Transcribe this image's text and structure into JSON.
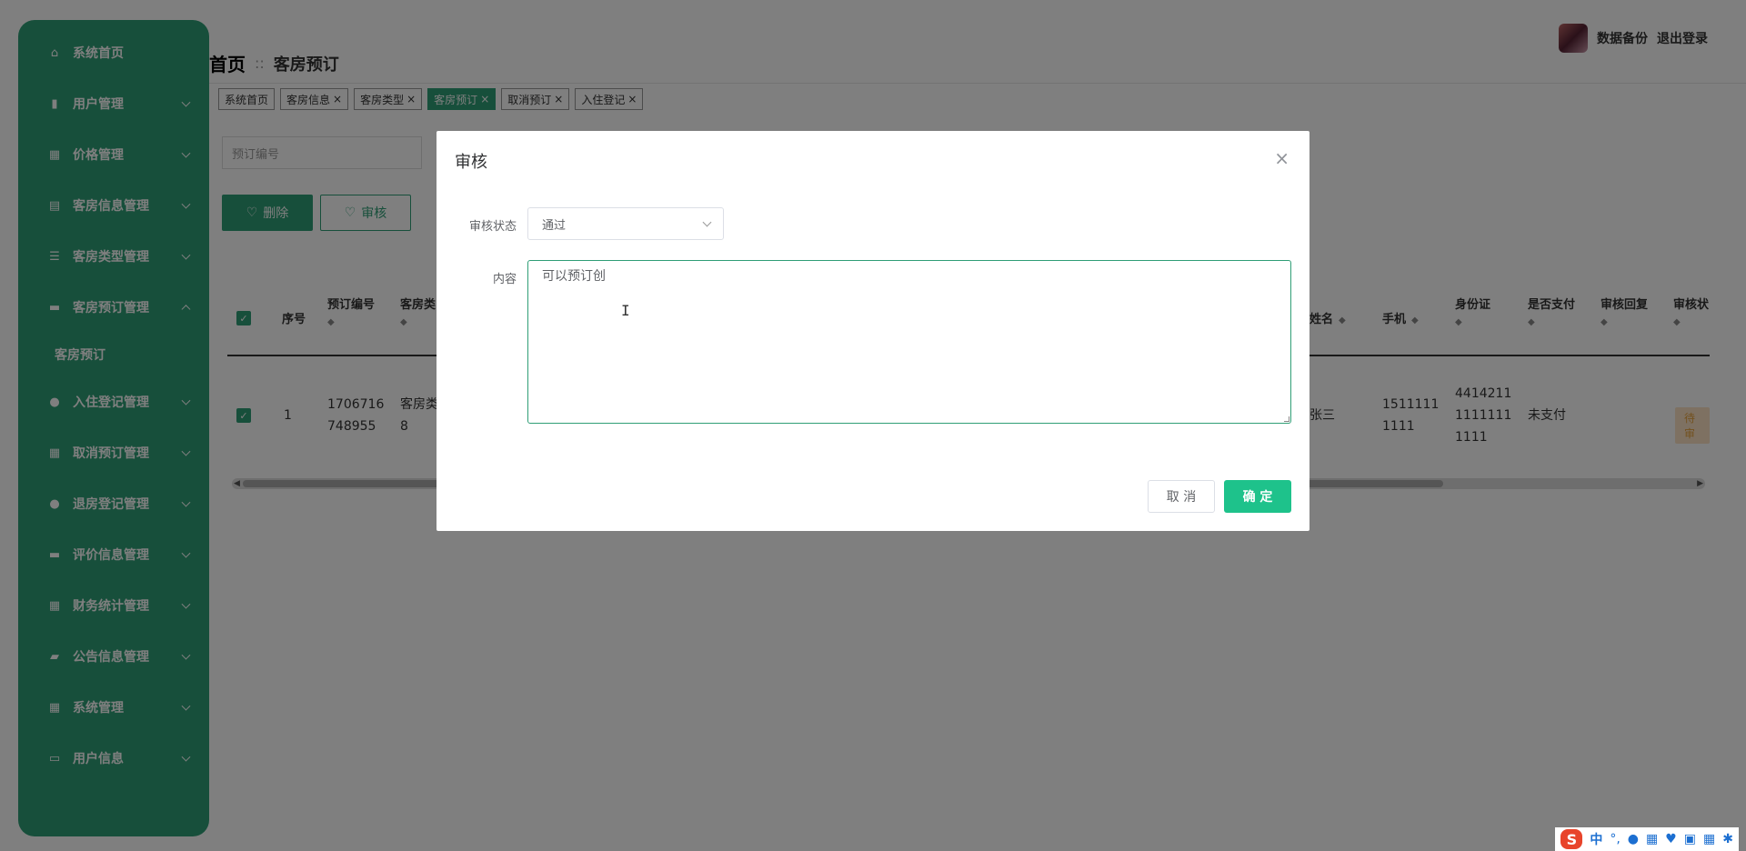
{
  "sidebar": {
    "items": [
      {
        "icon": "home-icon",
        "label": "系统首页"
      },
      {
        "icon": "clipboard-icon",
        "label": "用户管理"
      },
      {
        "icon": "grid-icon",
        "label": "价格管理"
      },
      {
        "icon": "table-icon",
        "label": "客房信息管理"
      },
      {
        "icon": "sliders-icon",
        "label": "客房类型管理"
      },
      {
        "icon": "monitor-icon",
        "label": "客房预订管理"
      },
      {
        "icon": "user-icon",
        "label": "入住登记管理"
      },
      {
        "icon": "grid-icon",
        "label": "取消预订管理"
      },
      {
        "icon": "bulb-icon",
        "label": "退房登记管理"
      },
      {
        "icon": "monitor-icon",
        "label": "评价信息管理"
      },
      {
        "icon": "grid-icon",
        "label": "财务统计管理"
      },
      {
        "icon": "chat-icon",
        "label": "公告信息管理"
      },
      {
        "icon": "grid-icon",
        "label": "系统管理"
      },
      {
        "icon": "card-icon",
        "label": "用户信息"
      }
    ],
    "submenu": {
      "label": "客房预订"
    }
  },
  "header": {
    "breadcrumb_home": "首页",
    "breadcrumb_sep": "::",
    "breadcrumb_current": "客房预订",
    "backup_label": "数据备份",
    "logout_label": "退出登录"
  },
  "tags": [
    {
      "label": "系统首页",
      "closable": false
    },
    {
      "label": "客房信息",
      "closable": true
    },
    {
      "label": "客房类型",
      "closable": true
    },
    {
      "label": "客房预订",
      "closable": true,
      "active": true
    },
    {
      "label": "取消预订",
      "closable": true
    },
    {
      "label": "入住登记",
      "closable": true
    }
  ],
  "search": {
    "placeholder": "预订编号"
  },
  "actions": {
    "delete_label": "删除",
    "audit_label": "审核"
  },
  "table": {
    "headers": {
      "index": "序号",
      "booking_no": "预订编号",
      "room_type": "客房类",
      "name": "姓名",
      "phone": "手机",
      "id_card": "身份证",
      "paid": "是否支付",
      "audit_reply": "审核回复",
      "audit_status": "审核状"
    },
    "rows": [
      {
        "index": "1",
        "booking_no_l1": "1706716",
        "booking_no_l2": "748955",
        "room_type_l1": "客房类",
        "room_type_l2": "8",
        "name": "张三",
        "phone_l1": "1511111",
        "phone_l2": "1111",
        "id_l1": "4414211",
        "id_l2": "1111111",
        "id_l3": "1111",
        "paid": "未支付",
        "status": "待审"
      }
    ]
  },
  "modal": {
    "title": "审核",
    "status_label": "审核状态",
    "status_value": "通过",
    "content_label": "内容",
    "content_value": "可以预订创",
    "cancel_label": "取 消",
    "confirm_label": "确 定"
  },
  "ime": {
    "logo": "S",
    "mode": "中",
    "punct": "°,"
  }
}
